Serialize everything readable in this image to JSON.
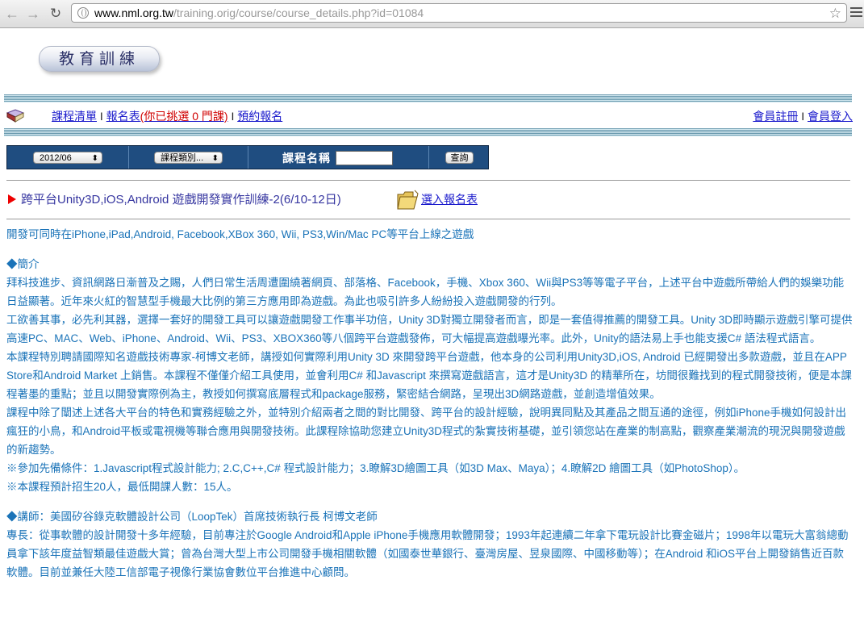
{
  "browser": {
    "url_host": "www.nml.org.tw",
    "url_path": "/training.orig/course/course_details.php?id=01084"
  },
  "logo_text": "教育訓練",
  "nav": {
    "course_list": "課程清單",
    "sep1": "I",
    "signup_form": "報名表",
    "selected_text": "(你已挑選 0 門課)",
    "sep2": "I",
    "reserve": "預約報名"
  },
  "user": {
    "register": "會員註冊",
    "sep": "I",
    "login": "會員登入"
  },
  "search": {
    "date_value": "2012/06",
    "category_value": "課程類別...",
    "name_label": "課程名稱",
    "go_label": "查詢"
  },
  "course": {
    "title": "跨平台Unity3D,iOS,Android 遊戲開發實作訓練-2(6/10-12日)",
    "enroll_link": "選入報名表"
  },
  "content": {
    "subtitle": "開發可同時在iPhone,iPad,Android, Facebook,XBox 360, Wii, PS3,Win/Mac PC等平台上線之遊戲",
    "intro_heading": "◆簡介",
    "intro_p1": "拜科技進步、資訊網路日漸普及之賜，人們日常生活周遭圍繞著網頁、部落格、Facebook，手機、Xbox 360、Wii與PS3等等電子平台，上述平台中遊戲所帶給人們的娛樂功能日益顯著。近年來火紅的智慧型手機最大比例的第三方應用即為遊戲。為此也吸引許多人紛紛投入遊戲開發的行列。",
    "intro_p2": "工欲善其事，必先利其器，選擇一套好的開發工具可以讓遊戲開發工作事半功倍，Unity 3D對獨立開發者而言，即是一套值得推薦的開發工具。Unity 3D即時顯示遊戲引擎可提供高速PC、MAC、Web、iPhone、Android、Wii、PS3、XBOX360等八個跨平台遊戲發佈，可大幅提高遊戲曝光率。此外，Unity的語法易上手也能支援C# 語法程式語言。",
    "intro_p3": "本課程特別聘請國際知名遊戲技術專家-柯博文老師，講授如何實際利用Unity 3D 來開發跨平台遊戲，他本身的公司利用Unity3D,iOS, Android 已經開發出多款遊戲，並且在APP Store和Android Market 上銷售。本課程不僅僅介紹工具使用，並會利用C# 和Javascript 來撰寫遊戲語言，這才是Unity3D 的精華所在，坊間很難找到的程式開發技術，便是本課程著墨的重點；並且以開發實際例為主，教授如何撰寫底層程式和package服務，緊密結合網路，呈現出3D網路遊戲，並創造增值效果。",
    "intro_p4": "課程中除了闡述上述各大平台的特色和實務經驗之外，並特別介紹兩者之間的對比開發、跨平台的設計經驗，說明異同點及其產品之間互通的途徑，例如iPhone手機如何設計出瘋狂的小鳥，和Android平板或電視機等聯合應用與開發技術。此課程除協助您建立Unity3D程式的紮實技術基礎，並引領您站在產業的制高點，觀察產業潮流的現況與開發遊戲的新趨勢。",
    "prereq": "※參加先備條件：1.Javascript程式設計能力; 2.C,C++,C# 程式設計能力；3.瞭解3D繪圖工具（如3D Max、Maya）；4.瞭解2D 繪圖工具（如PhotoShop）。",
    "quota": "※本課程預計招生20人，最低開課人數：15人。",
    "lecturer_heading": "◆講師：美國矽谷錄克軟體設計公司（LoopTek）首席技術執行長 柯博文老師",
    "lecturer_bio": "專長：從事軟體的設計開發十多年經驗，目前專注於Google Android和Apple iPhone手機應用軟體開發；1993年起連續二年拿下電玩設計比賽金磁片；1998年以電玩大富翁總動員拿下該年度益智類最佳遊戲大賞；曾為台灣大型上市公司開發手機相關軟體（如國泰世華銀行、臺灣房屋、昱泉國際、中國移動等）；在Android 和iOS平台上開發銷售近百款軟體。目前並兼任大陸工信部電子視像行業協會數位平台推進中心顧問。"
  },
  "colors": {
    "link": "#1a1acc",
    "body_text": "#1a73b8",
    "title_text": "#3636a0",
    "searchbar_bg": "#1f4d80",
    "stripe": "#6e9cb0",
    "accent_red": "#d00000"
  }
}
